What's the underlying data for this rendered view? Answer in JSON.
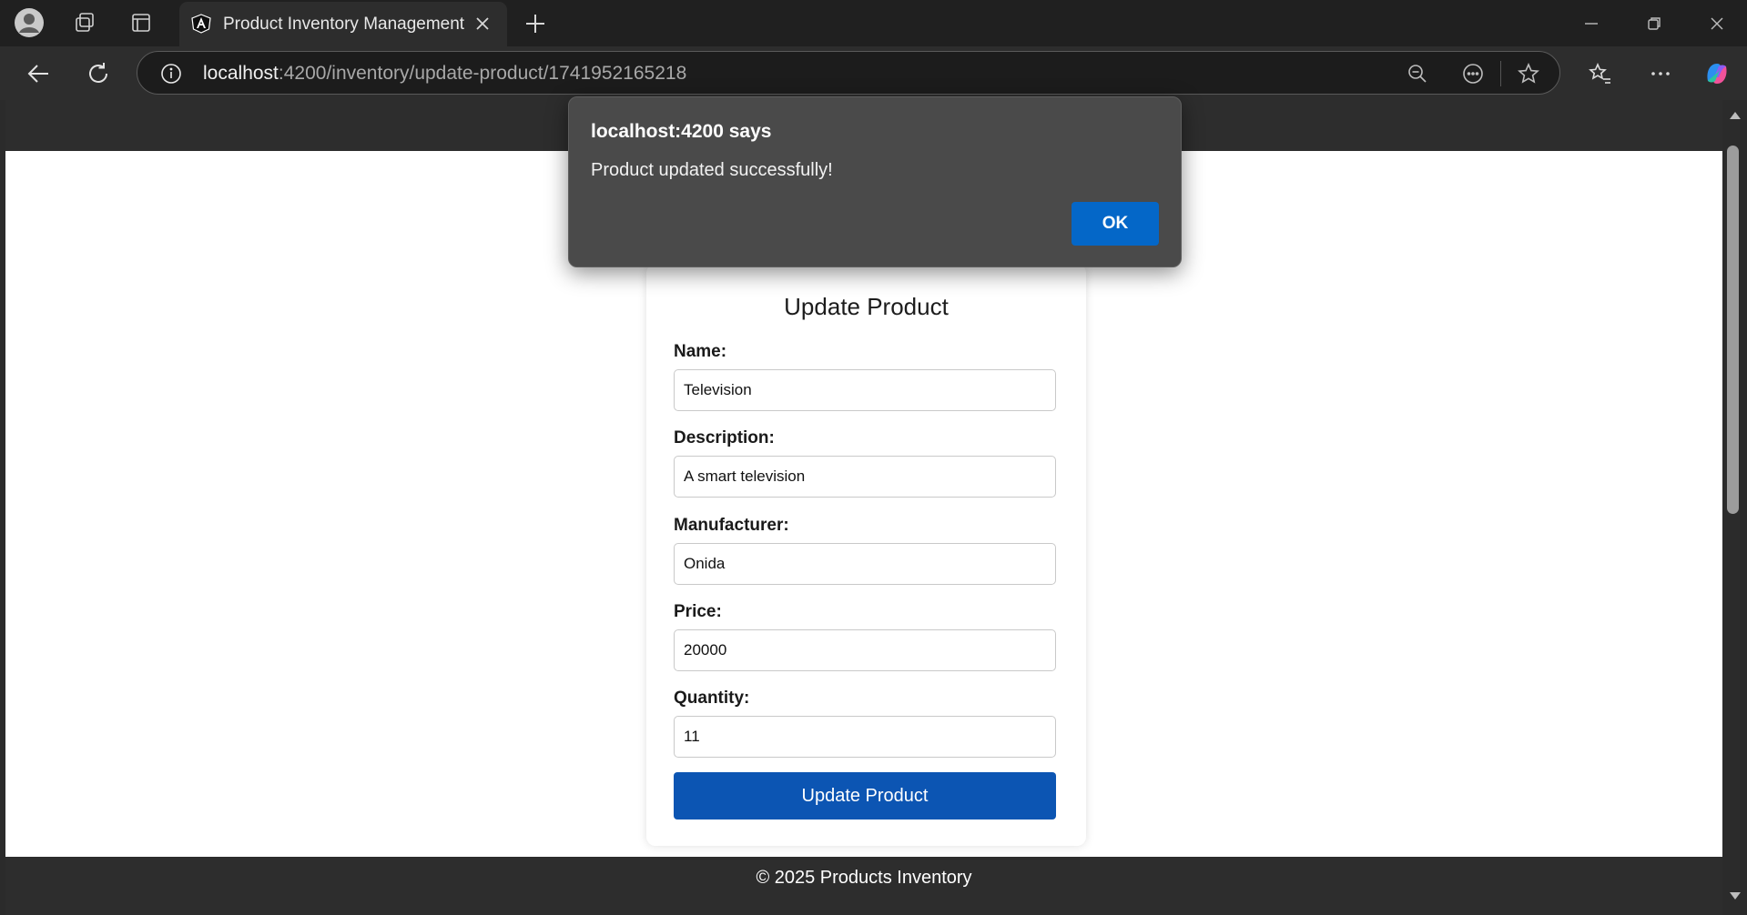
{
  "browser": {
    "tab_title": "Product Inventory Management",
    "url_host": "localhost",
    "url_rest": ":4200/inventory/update-product/1741952165218"
  },
  "dialog": {
    "title": "localhost:4200 says",
    "message": "Product updated successfully!",
    "ok_label": "OK"
  },
  "form": {
    "heading": "Update Product",
    "fields": [
      {
        "label": "Name:",
        "value": "Television"
      },
      {
        "label": "Description:",
        "value": "A smart television"
      },
      {
        "label": "Manufacturer:",
        "value": "Onida"
      },
      {
        "label": "Price:",
        "value": "20000"
      },
      {
        "label": "Quantity:",
        "value": "11"
      }
    ],
    "submit_label": "Update Product"
  },
  "footer": {
    "text": "© 2025 Products Inventory"
  },
  "colors": {
    "primary_button": "#0c55b3",
    "dialog_ok": "#0467c8",
    "chrome_dark": "#202020"
  }
}
